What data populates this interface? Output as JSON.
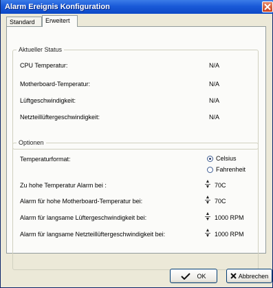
{
  "window": {
    "title": "Alarm Ereignis Konfiguration"
  },
  "tabs": [
    {
      "label": "Standard",
      "active": false
    },
    {
      "label": "Erweitert",
      "active": true
    }
  ],
  "status_group": {
    "title": "Aktueller Status",
    "rows": [
      {
        "label": "CPU Temperatur:",
        "value": "N/A"
      },
      {
        "label": "Motherboard-Temperatur:",
        "value": "N/A"
      },
      {
        "label": "Lüftgeschwindigkeit:",
        "value": "N/A"
      },
      {
        "label": "Netzteillüftergeschwindigkeit:",
        "value": "N/A"
      }
    ]
  },
  "options_group": {
    "title": "Optionen",
    "format_label": "Temperaturformat:",
    "format_options": [
      {
        "label": "Celsius",
        "selected": true
      },
      {
        "label": "Fahrenheit",
        "selected": false
      }
    ],
    "alarms": [
      {
        "label": "Zu hohe Temperatur Alarm bei :",
        "value": "70C"
      },
      {
        "label": "Alarm für hohe Motherboard-Temperatur bei:",
        "value": "70C"
      },
      {
        "label": "Alarm für langsame Lüftergeschwindigkeit bei:",
        "value": "1000 RPM"
      },
      {
        "label": "Alarm für langsame Netzteillüftergeschwindigkeit bei:",
        "value": "1000 RPM"
      }
    ]
  },
  "buttons": {
    "ok": {
      "label": "OK",
      "icon": "checkmark-icon"
    },
    "cancel": {
      "label": "Abbrechen",
      "icon": "x-icon"
    }
  },
  "colors": {
    "titlebar": "#0c48c6",
    "window_bg": "#ece9d8",
    "panel_bg": "#fbfbf9"
  }
}
